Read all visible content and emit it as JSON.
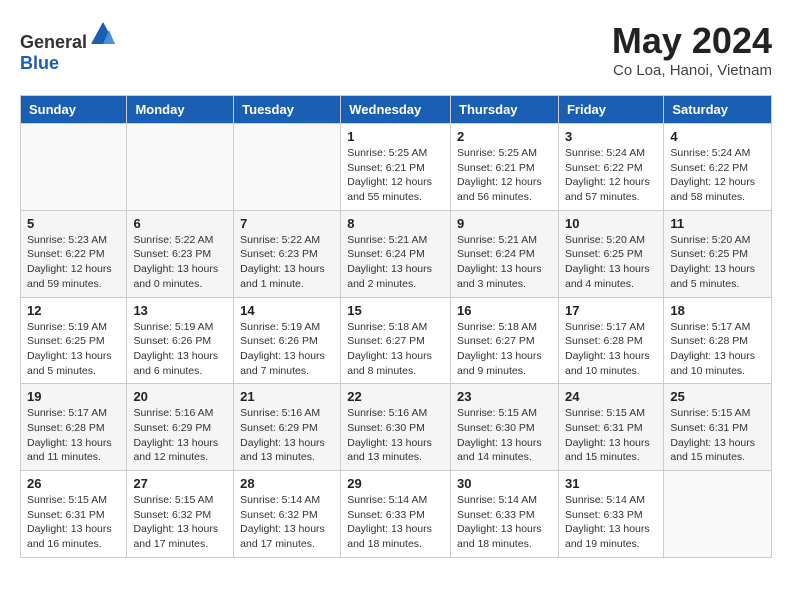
{
  "header": {
    "logo_general": "General",
    "logo_blue": "Blue",
    "month_year": "May 2024",
    "location": "Co Loa, Hanoi, Vietnam"
  },
  "weekdays": [
    "Sunday",
    "Monday",
    "Tuesday",
    "Wednesday",
    "Thursday",
    "Friday",
    "Saturday"
  ],
  "weeks": [
    [
      {
        "day": "",
        "info": ""
      },
      {
        "day": "",
        "info": ""
      },
      {
        "day": "",
        "info": ""
      },
      {
        "day": "1",
        "info": "Sunrise: 5:25 AM\nSunset: 6:21 PM\nDaylight: 12 hours and 55 minutes."
      },
      {
        "day": "2",
        "info": "Sunrise: 5:25 AM\nSunset: 6:21 PM\nDaylight: 12 hours and 56 minutes."
      },
      {
        "day": "3",
        "info": "Sunrise: 5:24 AM\nSunset: 6:22 PM\nDaylight: 12 hours and 57 minutes."
      },
      {
        "day": "4",
        "info": "Sunrise: 5:24 AM\nSunset: 6:22 PM\nDaylight: 12 hours and 58 minutes."
      }
    ],
    [
      {
        "day": "5",
        "info": "Sunrise: 5:23 AM\nSunset: 6:22 PM\nDaylight: 12 hours and 59 minutes."
      },
      {
        "day": "6",
        "info": "Sunrise: 5:22 AM\nSunset: 6:23 PM\nDaylight: 13 hours and 0 minutes."
      },
      {
        "day": "7",
        "info": "Sunrise: 5:22 AM\nSunset: 6:23 PM\nDaylight: 13 hours and 1 minute."
      },
      {
        "day": "8",
        "info": "Sunrise: 5:21 AM\nSunset: 6:24 PM\nDaylight: 13 hours and 2 minutes."
      },
      {
        "day": "9",
        "info": "Sunrise: 5:21 AM\nSunset: 6:24 PM\nDaylight: 13 hours and 3 minutes."
      },
      {
        "day": "10",
        "info": "Sunrise: 5:20 AM\nSunset: 6:25 PM\nDaylight: 13 hours and 4 minutes."
      },
      {
        "day": "11",
        "info": "Sunrise: 5:20 AM\nSunset: 6:25 PM\nDaylight: 13 hours and 5 minutes."
      }
    ],
    [
      {
        "day": "12",
        "info": "Sunrise: 5:19 AM\nSunset: 6:25 PM\nDaylight: 13 hours and 5 minutes."
      },
      {
        "day": "13",
        "info": "Sunrise: 5:19 AM\nSunset: 6:26 PM\nDaylight: 13 hours and 6 minutes."
      },
      {
        "day": "14",
        "info": "Sunrise: 5:19 AM\nSunset: 6:26 PM\nDaylight: 13 hours and 7 minutes."
      },
      {
        "day": "15",
        "info": "Sunrise: 5:18 AM\nSunset: 6:27 PM\nDaylight: 13 hours and 8 minutes."
      },
      {
        "day": "16",
        "info": "Sunrise: 5:18 AM\nSunset: 6:27 PM\nDaylight: 13 hours and 9 minutes."
      },
      {
        "day": "17",
        "info": "Sunrise: 5:17 AM\nSunset: 6:28 PM\nDaylight: 13 hours and 10 minutes."
      },
      {
        "day": "18",
        "info": "Sunrise: 5:17 AM\nSunset: 6:28 PM\nDaylight: 13 hours and 10 minutes."
      }
    ],
    [
      {
        "day": "19",
        "info": "Sunrise: 5:17 AM\nSunset: 6:28 PM\nDaylight: 13 hours and 11 minutes."
      },
      {
        "day": "20",
        "info": "Sunrise: 5:16 AM\nSunset: 6:29 PM\nDaylight: 13 hours and 12 minutes."
      },
      {
        "day": "21",
        "info": "Sunrise: 5:16 AM\nSunset: 6:29 PM\nDaylight: 13 hours and 13 minutes."
      },
      {
        "day": "22",
        "info": "Sunrise: 5:16 AM\nSunset: 6:30 PM\nDaylight: 13 hours and 13 minutes."
      },
      {
        "day": "23",
        "info": "Sunrise: 5:15 AM\nSunset: 6:30 PM\nDaylight: 13 hours and 14 minutes."
      },
      {
        "day": "24",
        "info": "Sunrise: 5:15 AM\nSunset: 6:31 PM\nDaylight: 13 hours and 15 minutes."
      },
      {
        "day": "25",
        "info": "Sunrise: 5:15 AM\nSunset: 6:31 PM\nDaylight: 13 hours and 15 minutes."
      }
    ],
    [
      {
        "day": "26",
        "info": "Sunrise: 5:15 AM\nSunset: 6:31 PM\nDaylight: 13 hours and 16 minutes."
      },
      {
        "day": "27",
        "info": "Sunrise: 5:15 AM\nSunset: 6:32 PM\nDaylight: 13 hours and 17 minutes."
      },
      {
        "day": "28",
        "info": "Sunrise: 5:14 AM\nSunset: 6:32 PM\nDaylight: 13 hours and 17 minutes."
      },
      {
        "day": "29",
        "info": "Sunrise: 5:14 AM\nSunset: 6:33 PM\nDaylight: 13 hours and 18 minutes."
      },
      {
        "day": "30",
        "info": "Sunrise: 5:14 AM\nSunset: 6:33 PM\nDaylight: 13 hours and 18 minutes."
      },
      {
        "day": "31",
        "info": "Sunrise: 5:14 AM\nSunset: 6:33 PM\nDaylight: 13 hours and 19 minutes."
      },
      {
        "day": "",
        "info": ""
      }
    ]
  ]
}
